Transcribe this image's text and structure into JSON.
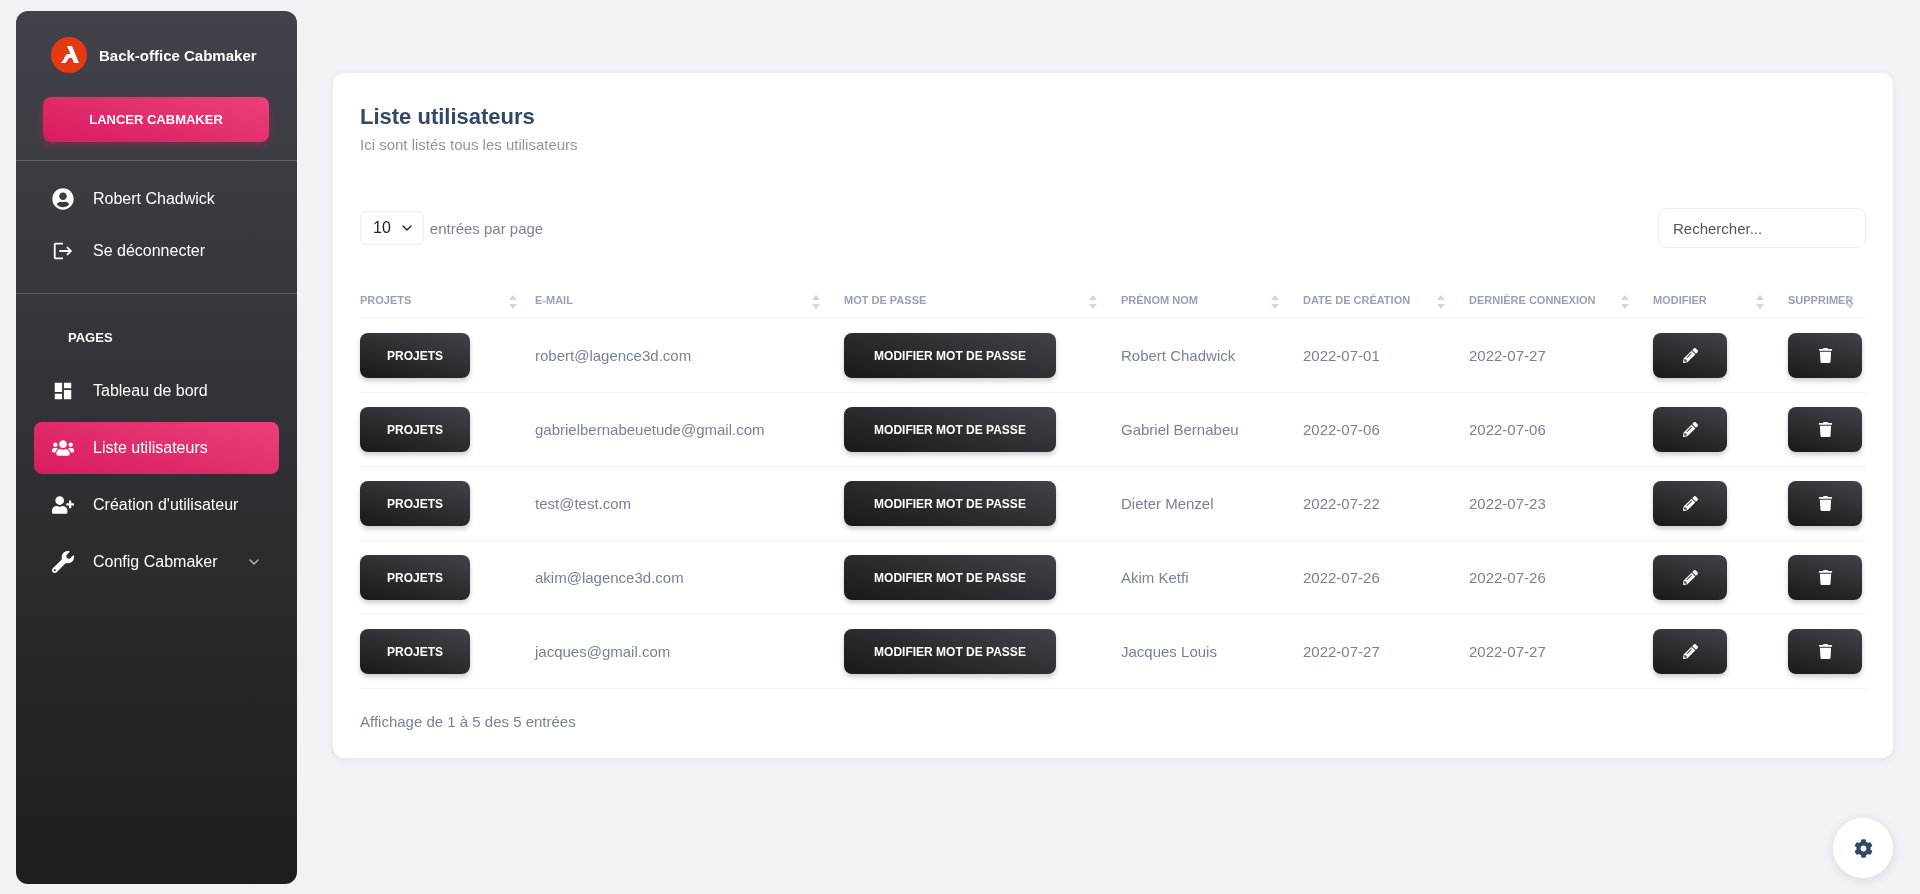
{
  "sidebar": {
    "brand": "Back-office Cabmaker",
    "launch_button": "LANCER CABMAKER",
    "account": [
      {
        "kind": "user",
        "label": "Robert Chadwick"
      },
      {
        "kind": "logout",
        "label": "Se déconnecter"
      }
    ],
    "section_title": "PAGES",
    "items": [
      {
        "kind": "dashboard",
        "label": "Tableau de bord",
        "selected": false
      },
      {
        "kind": "users",
        "label": "Liste utilisateurs",
        "selected": true
      },
      {
        "kind": "add-user",
        "label": "Création d'utilisateur",
        "selected": false
      },
      {
        "kind": "wrench",
        "label": "Config Cabmaker",
        "selected": false,
        "expanded": false
      }
    ]
  },
  "card": {
    "title": "Liste utilisateurs",
    "subtitle": "Ici sont listés tous les utilisateurs",
    "page_size": "10",
    "page_size_label": "entrées par page",
    "search": {
      "placeholder": "Rechercher..."
    },
    "table": {
      "columns": [
        "PROJETS",
        "E-MAIL",
        "MOT DE PASSE",
        "PRÉNOM NOM",
        "DATE DE CRÉATION",
        "DERNIÈRE CONNEXION",
        "MODIFIER",
        "SUPPRIMER"
      ],
      "rows": [
        {
          "projects": "PROJETS",
          "email": "robert@lagence3d.com",
          "password": "MODIFIER MOT DE PASSE",
          "name": "Robert Chadwick",
          "created": "2022-07-01",
          "last_login": "2022-07-27"
        },
        {
          "projects": "PROJETS",
          "email": "gabrielbernabeuetude@gmail.com",
          "password": "MODIFIER MOT DE PASSE",
          "name": "Gabriel Bernabeu",
          "created": "2022-07-06",
          "last_login": "2022-07-06"
        },
        {
          "projects": "PROJETS",
          "email": "test@test.com",
          "password": "MODIFIER MOT DE PASSE",
          "name": "Dieter Menzel",
          "created": "2022-07-22",
          "last_login": "2022-07-23"
        },
        {
          "projects": "PROJETS",
          "email": "akim@lagence3d.com",
          "password": "MODIFIER MOT DE PASSE",
          "name": "Akim Ketfi",
          "created": "2022-07-26",
          "last_login": "2022-07-26"
        },
        {
          "projects": "PROJETS",
          "email": "jacques@gmail.com",
          "password": "MODIFIER MOT DE PASSE",
          "name": "Jacques Louis",
          "created": "2022-07-27",
          "last_login": "2022-07-27"
        }
      ]
    },
    "footer": "Affichage de 1 à 5 des 5 entrées"
  }
}
